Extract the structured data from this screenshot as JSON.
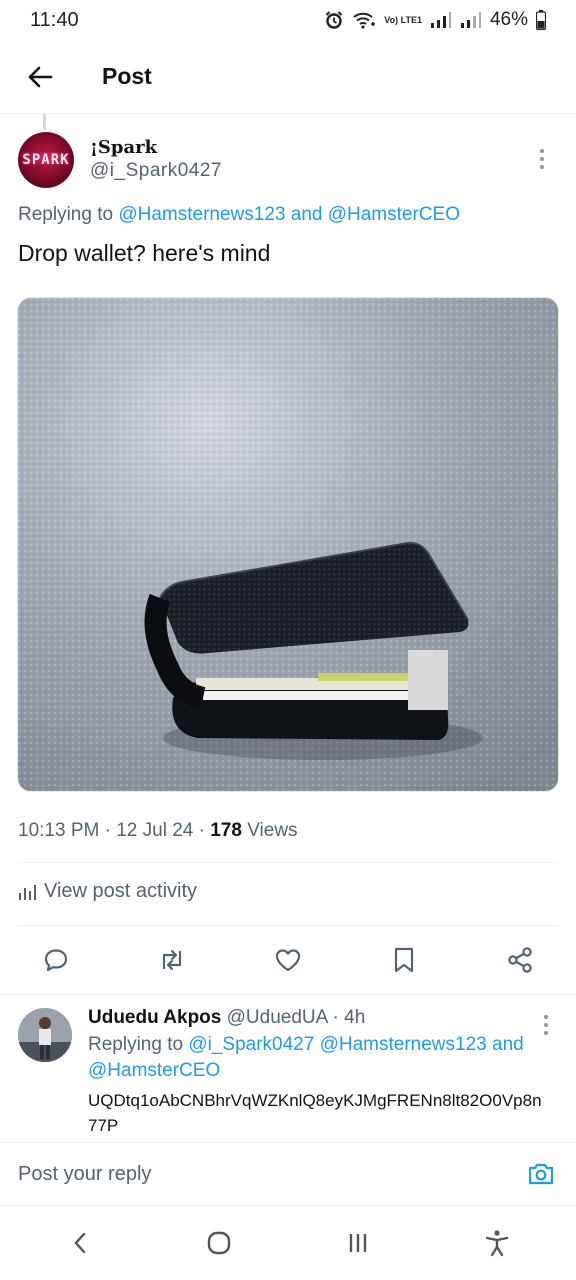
{
  "status_bar": {
    "time": "11:40",
    "network": "Vo) LTE1",
    "battery": "46%"
  },
  "header": {
    "title": "Post"
  },
  "post": {
    "author_name": "¡Spark",
    "author_handle": "@i_Spark0427",
    "avatar_text": "SPARK",
    "replying_prefix": "Replying to ",
    "replying_handles": "@Hamsternews123 and @HamsterCEO",
    "text": "Drop wallet? here's mind",
    "time": "10:13 PM",
    "date": "12 Jul 24",
    "views_count": "178",
    "views_label": "Views",
    "view_activity": "View post activity"
  },
  "actions": [
    {
      "icon": "reply-icon"
    },
    {
      "icon": "retweet-icon"
    },
    {
      "icon": "like-icon"
    },
    {
      "icon": "bookmark-icon"
    },
    {
      "icon": "share-icon"
    }
  ],
  "reply": {
    "author_name": "Uduedu Akpos",
    "author_handle": "@UduedUA",
    "age": "4h",
    "replying_prefix": "Replying to ",
    "replying_handles": "@i_Spark0427 @Hamsternews123 and @HamsterCEO",
    "text": "UQDtq1oAbCNBhrVqWZKnlQ8eyKJMgFRENn8lt82O0Vp8n77P"
  },
  "composer": {
    "placeholder": "Post your reply"
  },
  "colors": {
    "accent": "#1d9bf0",
    "text": "#0f1419",
    "secondary": "#536471"
  }
}
